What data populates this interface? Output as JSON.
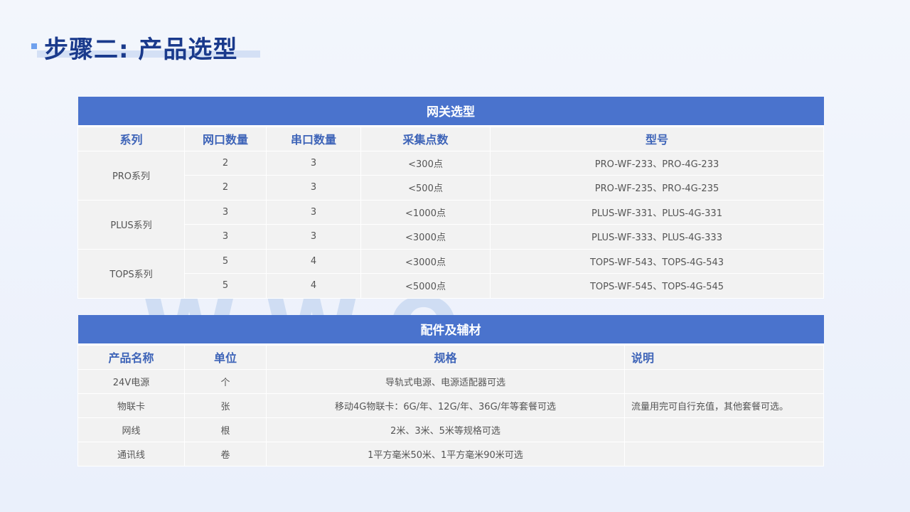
{
  "page": {
    "title": "步骤二: 产品选型",
    "watermark": "WWO"
  },
  "gateway_table": {
    "caption": "网关选型",
    "headers": [
      "系列",
      "网口数量",
      "串口数量",
      "采集点数",
      "型号"
    ],
    "groups": [
      {
        "series": "PRO系列",
        "rows": [
          [
            "2",
            "3",
            "<300点",
            "PRO-WF-233、PRO-4G-233"
          ],
          [
            "2",
            "3",
            "<500点",
            "PRO-WF-235、PRO-4G-235"
          ]
        ]
      },
      {
        "series": "PLUS系列",
        "rows": [
          [
            "3",
            "3",
            "<1000点",
            "PLUS-WF-331、PLUS-4G-331"
          ],
          [
            "3",
            "3",
            "<3000点",
            "PLUS-WF-333、PLUS-4G-333"
          ]
        ]
      },
      {
        "series": "TOPS系列",
        "rows": [
          [
            "5",
            "4",
            "<3000点",
            "TOPS-WF-543、TOPS-4G-543"
          ],
          [
            "5",
            "4",
            "<5000点",
            "TOPS-WF-545、TOPS-4G-545"
          ]
        ]
      }
    ]
  },
  "accessory_table": {
    "caption": "配件及辅材",
    "headers": [
      "产品名称",
      "单位",
      "规格",
      "说明"
    ],
    "rows": [
      [
        "24V电源",
        "个",
        "导轨式电源、电源适配器可选",
        ""
      ],
      [
        "物联卡",
        "张",
        "移动4G物联卡：6G/年、12G/年、36G/年等套餐可选",
        "流量用完可自行充值，其他套餐可选。"
      ],
      [
        "网线",
        "根",
        "2米、3米、5米等规格可选",
        ""
      ],
      [
        "通讯线",
        "卷",
        "1平方毫米50米、1平方毫米90米可选",
        ""
      ]
    ]
  },
  "colors": {
    "title": "#1a3a8c",
    "caption_bg": "#4a73cd",
    "header_text": "#3e64b8",
    "cell_bg": "#f2f2f2"
  }
}
